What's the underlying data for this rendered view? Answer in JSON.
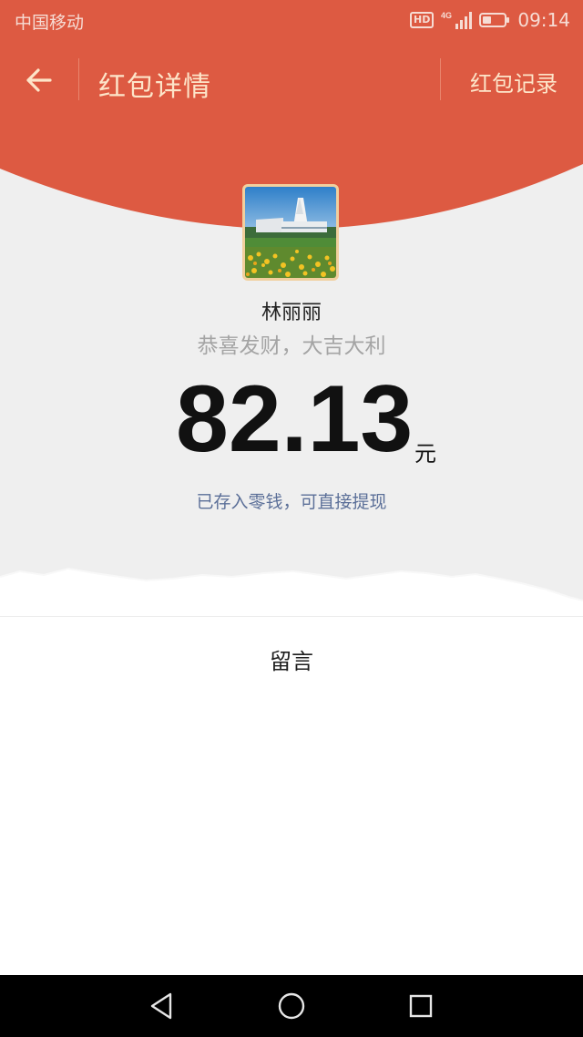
{
  "status_bar": {
    "carrier": "中国移动",
    "hd_badge": "HD",
    "network_icon": "signal-4g-icon",
    "battery_icon": "battery-icon",
    "time": "09:14"
  },
  "nav_bar": {
    "back_icon": "arrow-left-icon",
    "title": "红包详情",
    "records_label": "红包记录"
  },
  "red_packet": {
    "avatar_icon": "scenic-building-photo",
    "sender_name": "林丽丽",
    "greeting": "恭喜发财，大吉大利",
    "amount": "82.13",
    "currency_unit": "元",
    "stored_note": "已存入零钱，可直接提现"
  },
  "message_section": {
    "label": "留言"
  },
  "system_nav": {
    "back_icon": "triangle-back-icon",
    "home_icon": "circle-home-icon",
    "recent_icon": "square-recent-icon"
  },
  "colors": {
    "header_red": "#dd5a42",
    "header_text": "#fde5c9",
    "link_blue": "#5b6f98",
    "grey_band": "#efefef",
    "avatar_border": "#f1cf9d"
  }
}
